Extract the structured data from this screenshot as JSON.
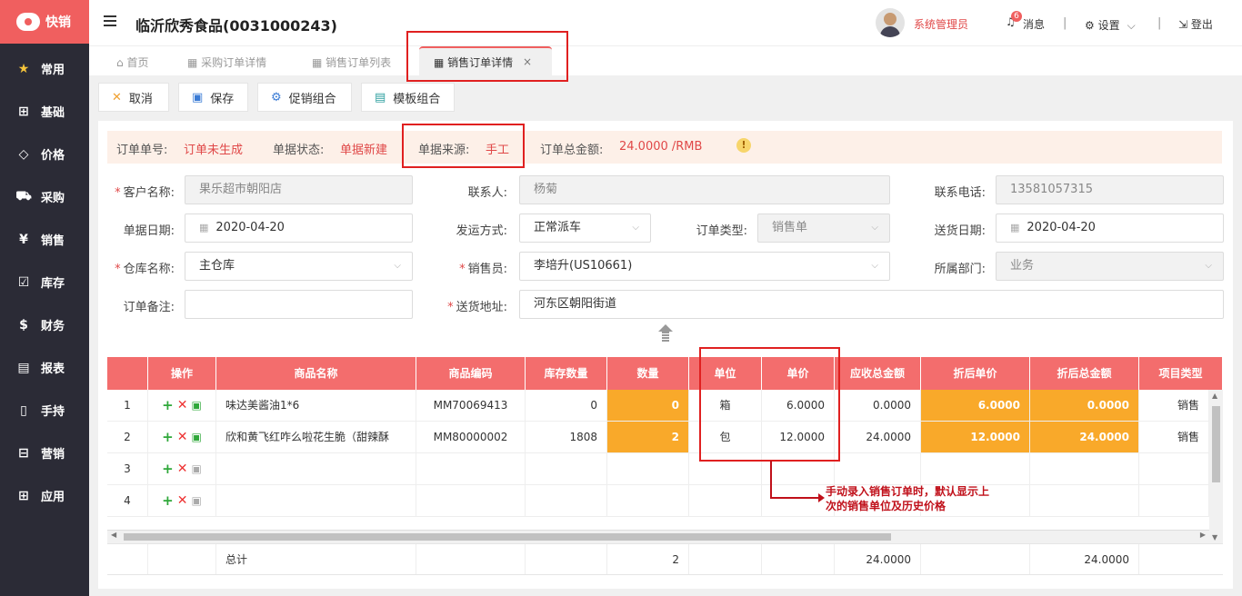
{
  "app": {
    "logo_text": "快销",
    "brand_color": "#f05f5f"
  },
  "sidebar": {
    "items": [
      {
        "label": "常用",
        "icon": "star-icon"
      },
      {
        "label": "基础",
        "icon": "grid-icon"
      },
      {
        "label": "价格",
        "icon": "tag-icon"
      },
      {
        "label": "采购",
        "icon": "cart-icon"
      },
      {
        "label": "销售",
        "icon": "yen-icon"
      },
      {
        "label": "库存",
        "icon": "checkbox-icon"
      },
      {
        "label": "财务",
        "icon": "money-bag-icon"
      },
      {
        "label": "报表",
        "icon": "report-icon"
      },
      {
        "label": "手持",
        "icon": "handheld-icon"
      },
      {
        "label": "营销",
        "icon": "marketing-icon"
      },
      {
        "label": "应用",
        "icon": "apps-icon"
      }
    ]
  },
  "header": {
    "title": "临沂欣秀食品(0031000243)",
    "user": "系统管理员",
    "msg_count": "6",
    "msg": "消息",
    "settings": "设置",
    "logout": "登出"
  },
  "tabs": [
    {
      "label": "首页"
    },
    {
      "label": "采购订单详情"
    },
    {
      "label": "销售订单列表"
    },
    {
      "label": "销售订单详情"
    }
  ],
  "toolbar": {
    "cancel": "取消",
    "save": "保存",
    "promo": "促销组合",
    "template": "模板组合"
  },
  "info": {
    "order_no_label": "订单单号:",
    "order_no": "订单未生成",
    "status_label": "单据状态:",
    "status": "单据新建",
    "source_label": "单据来源:",
    "source": "手工",
    "total_label": "订单总金额:",
    "total": "24.0000 /RMB"
  },
  "form": {
    "customer_label": "客户名称:",
    "customer": "果乐超市朝阳店",
    "contact_label": "联系人:",
    "contact": "杨菊",
    "phone_label": "联系电话:",
    "phone": "13581057315",
    "date_label": "单据日期:",
    "date": "2020-04-20",
    "ship_label": "发运方式:",
    "ship": "正常派车",
    "type_label": "订单类型:",
    "type": "销售单",
    "deliver_label": "送货日期:",
    "deliver": "2020-04-20",
    "wh_label": "仓库名称:",
    "wh": "主仓库",
    "sales_label": "销售员:",
    "sales": "李培升(US10661)",
    "dept_label": "所属部门:",
    "dept": "业务",
    "remark_label": "订单备注:",
    "remark": "",
    "addr_label": "送货地址:",
    "addr": "河东区朝阳街道"
  },
  "grid": {
    "headers": [
      "",
      "操作",
      "商品名称",
      "商品编码",
      "库存数量",
      "数量",
      "单位",
      "单价",
      "应收总金额",
      "折后单价",
      "折后总金额",
      "项目类型"
    ],
    "rows": [
      {
        "idx": "1",
        "name": "味达美酱油1*6",
        "code": "MM70069413",
        "stock": "0",
        "qty": "0",
        "unit": "箱",
        "price": "6.0000",
        "amount": "0.0000",
        "dprice": "6.0000",
        "damount": "0.0000",
        "ptype": "销售"
      },
      {
        "idx": "2",
        "name": "欣和黄飞红咋么啦花生脆（甜辣酥",
        "code": "MM80000002",
        "stock": "1808",
        "qty": "2",
        "unit": "包",
        "price": "12.0000",
        "amount": "24.0000",
        "dprice": "12.0000",
        "damount": "24.0000",
        "ptype": "销售"
      },
      {
        "idx": "3",
        "name": "",
        "code": "",
        "stock": "",
        "qty": "",
        "unit": "",
        "price": "",
        "amount": "",
        "dprice": "",
        "damount": "",
        "ptype": ""
      },
      {
        "idx": "4",
        "name": "",
        "code": "",
        "stock": "",
        "qty": "",
        "unit": "",
        "price": "",
        "amount": "",
        "dprice": "",
        "damount": "",
        "ptype": ""
      }
    ],
    "total_label": "总计",
    "total_qty": "2",
    "total_amount": "24.0000",
    "total_damount": "24.0000"
  },
  "annotation": {
    "line1": "手动录入销售订单时，默认显示上",
    "line2": "次的销售单位及历史价格"
  }
}
